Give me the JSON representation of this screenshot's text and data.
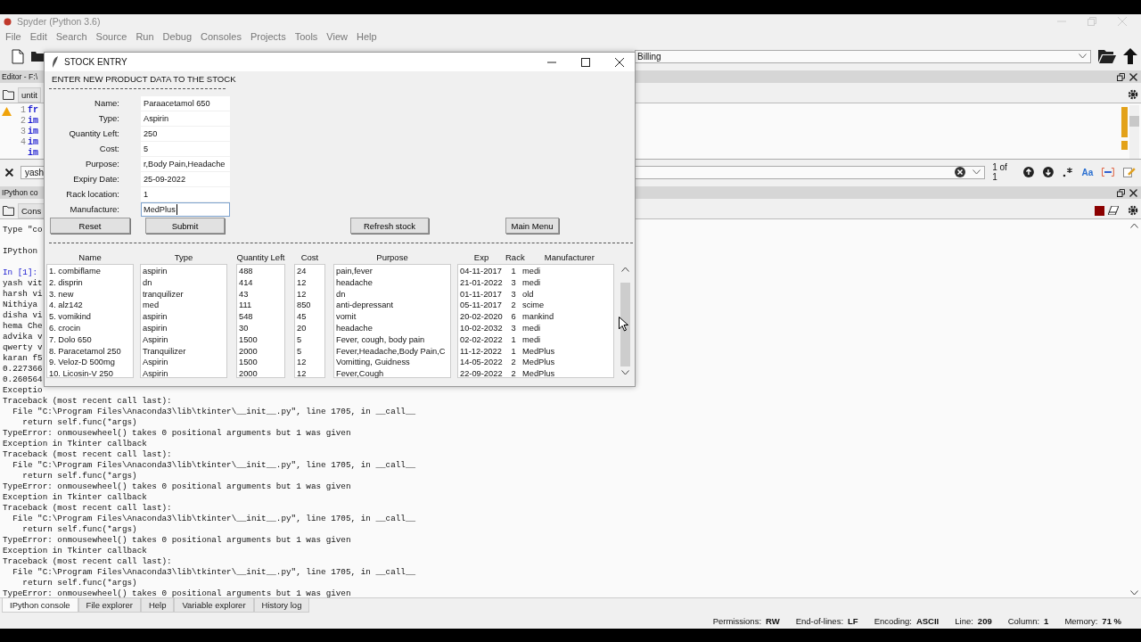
{
  "spyder": {
    "title": "Spyder (Python 3.6)",
    "menu": [
      "File",
      "Edit",
      "Search",
      "Source",
      "Run",
      "Debug",
      "Consoles",
      "Projects",
      "Tools",
      "View",
      "Help"
    ],
    "path": "Billing"
  },
  "editor": {
    "header": "Editor - F:\\",
    "tab": "untit",
    "lines": [
      {
        "number": "1",
        "code": "fr"
      },
      {
        "number": "2",
        "code": "im"
      },
      {
        "number": "3",
        "code": "im"
      },
      {
        "number": "4",
        "code": "im"
      },
      {
        "code": "im"
      }
    ]
  },
  "find": {
    "value": "yash",
    "matches": "1 of 1",
    "case_label": "Aa"
  },
  "console": {
    "header": "IPython co",
    "tab": "Cons",
    "lines": [
      {
        "text": "Type \"co",
        "kind": "plain",
        "gap_before": false
      },
      {
        "text": "IPython",
        "kind": "plain",
        "gap_before": true
      },
      {
        "text": "In [1]:",
        "kind": "prompt",
        "gap_before": true
      },
      {
        "text": "yash vit",
        "kind": "plain",
        "gap_before": false
      },
      {
        "text": "harsh vi",
        "kind": "plain",
        "gap_before": false
      },
      {
        "text": "Nithiya",
        "kind": "plain",
        "gap_before": false
      },
      {
        "text": "disha vi",
        "kind": "plain",
        "gap_before": false
      },
      {
        "text": "hema Che",
        "kind": "plain",
        "gap_before": false
      },
      {
        "text": "advika v",
        "kind": "plain",
        "gap_before": false
      },
      {
        "text": "qwerty v",
        "kind": "plain",
        "gap_before": false
      },
      {
        "text": "karan f5",
        "kind": "plain",
        "gap_before": false
      },
      {
        "text": "0.227366",
        "kind": "plain",
        "gap_before": false
      },
      {
        "text": "0.260564",
        "kind": "plain",
        "gap_before": false
      },
      {
        "text": "Exceptio",
        "kind": "plain",
        "gap_before": false
      },
      {
        "text": "Traceback (most recent call last):",
        "kind": "plain",
        "gap_before": false
      },
      {
        "text": "  File \"C:\\Program Files\\Anaconda3\\lib\\tkinter\\__init__.py\", line 1705, in __call__",
        "kind": "plain",
        "gap_before": false
      },
      {
        "text": "    return self.func(*args)",
        "kind": "plain",
        "gap_before": false
      },
      {
        "text": "TypeError: onmousewheel() takes 0 positional arguments but 1 was given",
        "kind": "plain",
        "gap_before": false
      },
      {
        "text": "Exception in Tkinter callback",
        "kind": "plain",
        "gap_before": false
      },
      {
        "text": "Traceback (most recent call last):",
        "kind": "plain",
        "gap_before": false
      },
      {
        "text": "  File \"C:\\Program Files\\Anaconda3\\lib\\tkinter\\__init__.py\", line 1705, in __call__",
        "kind": "plain",
        "gap_before": false
      },
      {
        "text": "    return self.func(*args)",
        "kind": "plain",
        "gap_before": false
      },
      {
        "text": "TypeError: onmousewheel() takes 0 positional arguments but 1 was given",
        "kind": "plain",
        "gap_before": false
      },
      {
        "text": "Exception in Tkinter callback",
        "kind": "plain",
        "gap_before": false
      },
      {
        "text": "Traceback (most recent call last):",
        "kind": "plain",
        "gap_before": false
      },
      {
        "text": "  File \"C:\\Program Files\\Anaconda3\\lib\\tkinter\\__init__.py\", line 1705, in __call__",
        "kind": "plain",
        "gap_before": false
      },
      {
        "text": "    return self.func(*args)",
        "kind": "plain",
        "gap_before": false
      },
      {
        "text": "TypeError: onmousewheel() takes 0 positional arguments but 1 was given",
        "kind": "plain",
        "gap_before": false
      },
      {
        "text": "Exception in Tkinter callback",
        "kind": "plain",
        "gap_before": false
      },
      {
        "text": "Traceback (most recent call last):",
        "kind": "plain",
        "gap_before": false
      },
      {
        "text": "  File \"C:\\Program Files\\Anaconda3\\lib\\tkinter\\__init__.py\", line 1705, in __call__",
        "kind": "plain",
        "gap_before": false
      },
      {
        "text": "    return self.func(*args)",
        "kind": "plain",
        "gap_before": false
      },
      {
        "text": "TypeError: onmousewheel() takes 0 positional arguments but 1 was given",
        "kind": "plain",
        "gap_before": false
      }
    ]
  },
  "dock_tabs": [
    {
      "label": "IPython console",
      "selected": true
    },
    {
      "label": "File explorer",
      "selected": false
    },
    {
      "label": "Help",
      "selected": false
    },
    {
      "label": "Variable explorer",
      "selected": false
    },
    {
      "label": "History log",
      "selected": false
    }
  ],
  "status_bar": [
    {
      "label": "Permissions:",
      "value": "RW"
    },
    {
      "label": "End-of-lines:",
      "value": "LF"
    },
    {
      "label": "Encoding:",
      "value": "ASCII"
    },
    {
      "label": "Line:",
      "value": "209"
    },
    {
      "label": "Column:",
      "value": "1"
    },
    {
      "label": "Memory:",
      "value": "71 %"
    }
  ],
  "dialog": {
    "title": "STOCK ENTRY",
    "heading": "ENTER NEW PRODUCT DATA TO THE STOCK",
    "fields": [
      {
        "label": "Name:",
        "value": "Paraacetamol 650",
        "focused": false
      },
      {
        "label": "Type:",
        "value": "Aspirin",
        "focused": false
      },
      {
        "label": "Quantity Left:",
        "value": "250",
        "focused": false
      },
      {
        "label": "Cost:",
        "value": "5",
        "focused": false
      },
      {
        "label": "Purpose:",
        "value": "r,Body Pain,Headache",
        "focused": false
      },
      {
        "label": "Expiry Date:",
        "value": "25-09-2022",
        "focused": false
      },
      {
        "label": "Rack location:",
        "value": "1",
        "focused": false
      },
      {
        "label": "Manufacture:",
        "value": "MedPlus",
        "focused": true
      }
    ],
    "buttons": [
      "Reset",
      "Submit",
      "Refresh stock",
      "Main Menu"
    ],
    "listboxes": [
      {
        "columns": [
          {
            "header": "Name",
            "cells": [
              "1. combiflame",
              "2. disprin",
              "3. new",
              "4. alz142",
              "5. vomikind",
              "6. crocin",
              "7. Dolo 650",
              "8. Paracetamol 250",
              "9. Veloz-D 500mg",
              "10. Licosin-V 250"
            ]
          }
        ]
      },
      {
        "columns": [
          {
            "header": "Type",
            "cells": [
              "aspirin",
              "dn",
              "tranquilizer",
              "med",
              "aspirin",
              "aspirin",
              "Aspirin",
              "Tranquilizer",
              "Aspirin",
              "Aspirin"
            ]
          }
        ]
      },
      {
        "columns": [
          {
            "header": "Quantity Left",
            "cells": [
              "488",
              "414",
              "43",
              "111",
              "548",
              "30",
              "1500",
              "2000",
              "1500",
              "2000"
            ]
          }
        ]
      },
      {
        "columns": [
          {
            "header": "Cost",
            "cells": [
              "24",
              "12",
              "12",
              "850",
              "45",
              "20",
              "5",
              "5",
              "12",
              "12"
            ]
          }
        ]
      },
      {
        "columns": [
          {
            "header": "Purpose",
            "cells": [
              "pain,fever",
              "headache",
              "dn",
              "anti-depressant",
              "vomit",
              "headache",
              "Fever, cough, body pain",
              "Fever,Headache,Body Pain,C",
              "Vomitting, Guidness",
              "Fever,Cough"
            ]
          }
        ]
      },
      {
        "columns": [
          {
            "header": "Exp",
            "cells": [
              "04-11-2017",
              "21-01-2022",
              "01-11-2017",
              "05-11-2017",
              "20-02-2020",
              "10-02-2032",
              "02-02-2022",
              "11-12-2022",
              "14-05-2022",
              "22-09-2022"
            ]
          },
          {
            "header": "Rack",
            "cells": [
              "1",
              "3",
              "3",
              "2",
              "6",
              "3",
              "1",
              "1",
              "2",
              "2"
            ]
          },
          {
            "header": "Manufacturer",
            "cells": [
              "medi",
              "medi",
              "old",
              "scime",
              "mankind",
              "medi",
              "medi",
              "MedPlus",
              "MedPlus",
              "MedPlus"
            ]
          }
        ]
      }
    ]
  }
}
